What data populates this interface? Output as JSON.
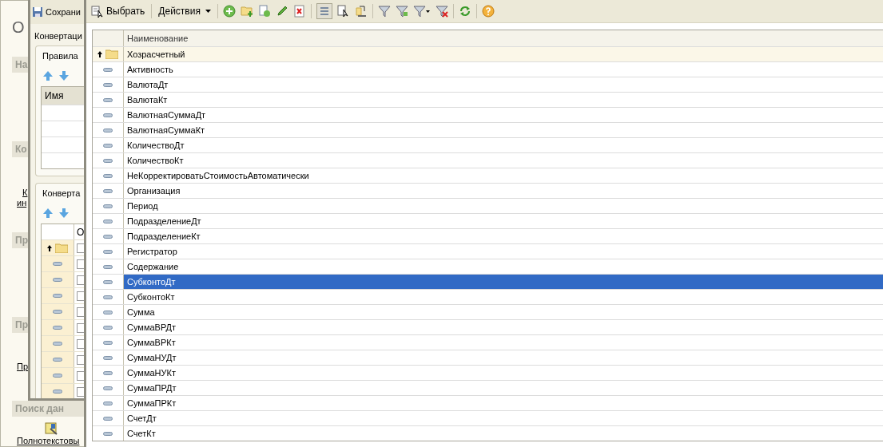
{
  "back_window": {
    "items": [
      {
        "kind": "big",
        "text": "О"
      },
      {
        "kind": "header",
        "text": "На"
      },
      {
        "kind": "header",
        "text": "Ко"
      },
      {
        "kind": "link",
        "text": "К"
      },
      {
        "kind": "link",
        "text": "ин"
      },
      {
        "kind": "header",
        "text": "Пр"
      },
      {
        "kind": "header",
        "text": "Пр"
      },
      {
        "kind": "link",
        "text": "Пр"
      },
      {
        "kind": "header",
        "text": "Поиск дан"
      },
      {
        "kind": "icon_link",
        "text": "Полнотекстовы"
      }
    ]
  },
  "middle_window": {
    "save_button": "Сохрани",
    "caption": "Конвертаци",
    "rules_tab": "Правила",
    "rules_table": {
      "column": "Имя"
    },
    "conv_tab": "Конверта",
    "conv_table": {
      "column": "О",
      "rows": [
        {
          "kind": "folder",
          "checked": false
        },
        {
          "kind": "field",
          "checked": false
        },
        {
          "kind": "field",
          "checked": false
        },
        {
          "kind": "field",
          "checked": false
        },
        {
          "kind": "field",
          "checked": false
        },
        {
          "kind": "field",
          "checked": false
        },
        {
          "kind": "field",
          "checked": false
        },
        {
          "kind": "field",
          "checked": false
        },
        {
          "kind": "field",
          "checked": false
        },
        {
          "kind": "field",
          "checked": false
        }
      ]
    }
  },
  "front_window": {
    "toolbar": {
      "select": "Выбрать",
      "actions": "Действия"
    },
    "table": {
      "column": "Наименование",
      "rows": [
        {
          "kind": "folder",
          "name": "Хозрасчетный",
          "selected": false
        },
        {
          "kind": "field",
          "name": "Активность",
          "selected": false
        },
        {
          "kind": "field",
          "name": "ВалютаДт",
          "selected": false
        },
        {
          "kind": "field",
          "name": "ВалютаКт",
          "selected": false
        },
        {
          "kind": "field",
          "name": "ВалютнаяСуммаДт",
          "selected": false
        },
        {
          "kind": "field",
          "name": "ВалютнаяСуммаКт",
          "selected": false
        },
        {
          "kind": "field",
          "name": "КоличествоДт",
          "selected": false
        },
        {
          "kind": "field",
          "name": "КоличествоКт",
          "selected": false
        },
        {
          "kind": "field",
          "name": "НеКорректироватьСтоимостьАвтоматически",
          "selected": false
        },
        {
          "kind": "field",
          "name": "Организация",
          "selected": false
        },
        {
          "kind": "field",
          "name": "Период",
          "selected": false
        },
        {
          "kind": "field",
          "name": "ПодразделениеДт",
          "selected": false
        },
        {
          "kind": "field",
          "name": "ПодразделениеКт",
          "selected": false
        },
        {
          "kind": "field",
          "name": "Регистратор",
          "selected": false
        },
        {
          "kind": "field",
          "name": "Содержание",
          "selected": false
        },
        {
          "kind": "field",
          "name": "СубконтоДт",
          "selected": true
        },
        {
          "kind": "field",
          "name": "СубконтоКт",
          "selected": false
        },
        {
          "kind": "field",
          "name": "Сумма",
          "selected": false
        },
        {
          "kind": "field",
          "name": "СуммаВРДт",
          "selected": false
        },
        {
          "kind": "field",
          "name": "СуммаВРКт",
          "selected": false
        },
        {
          "kind": "field",
          "name": "СуммаНУДт",
          "selected": false
        },
        {
          "kind": "field",
          "name": "СуммаНУКт",
          "selected": false
        },
        {
          "kind": "field",
          "name": "СуммаПРДт",
          "selected": false
        },
        {
          "kind": "field",
          "name": "СуммаПРКт",
          "selected": false
        },
        {
          "kind": "field",
          "name": "СчетДт",
          "selected": false
        },
        {
          "kind": "field",
          "name": "СчетКт",
          "selected": false
        }
      ]
    }
  }
}
